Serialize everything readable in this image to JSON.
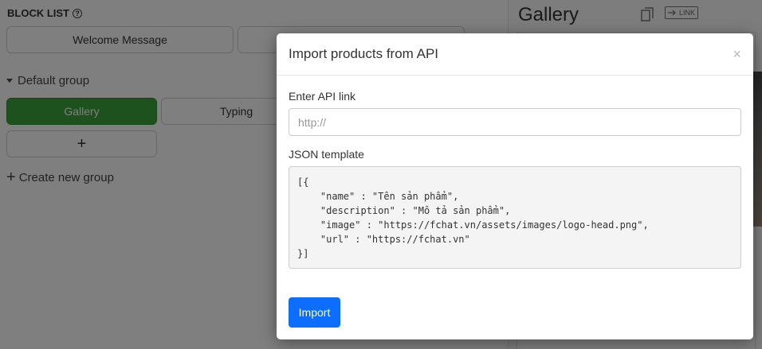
{
  "block_list": {
    "title": "BLOCK LIST",
    "blocks": [
      "Welcome Message",
      ""
    ]
  },
  "group": {
    "name": "Default group",
    "items": [
      "Gallery",
      "Typing"
    ],
    "add_symbol": "+",
    "create_label": "Create new group"
  },
  "right_panel": {
    "title": "Gallery",
    "link_label": "LINK"
  },
  "modal": {
    "title": "Import products from API",
    "close_symbol": "×",
    "api_label": "Enter API link",
    "api_value": "",
    "api_placeholder": "http://",
    "json_label": "JSON template",
    "json_template": "[{\n    \"name\" : \"Tên sản phẩm\",\n    \"description\" : \"Mô tả sản phẩm\",\n    \"image\" : \"https://fchat.vn/assets/images/logo-head.png\",\n    \"url\" : \"https://fchat.vn\"\n}]",
    "import_label": "Import"
  },
  "colors": {
    "primary": "#0d6efd",
    "active_block": "#3aa33a"
  }
}
